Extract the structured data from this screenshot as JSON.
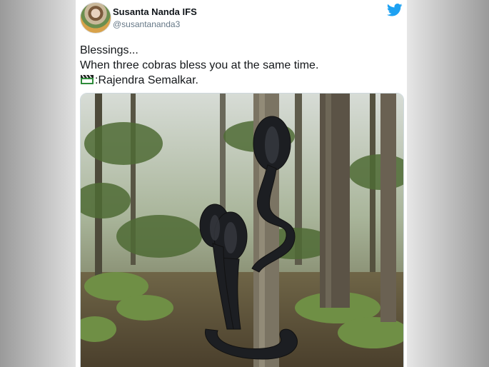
{
  "tweet": {
    "author_name": "Susanta Nanda IFS",
    "author_handle": "@susantananda3",
    "text_line_1": "Blessings...",
    "text_line_2": "When three cobras bless you at the same time.",
    "credit": ":Rajendra Semalkar.",
    "icons": [
      "twitter-bird-icon",
      "clapperboard-icon"
    ],
    "brand_color": "#1da1f2"
  },
  "photo": {
    "subject": "three black cobras coiled around a tree trunk in a forest"
  }
}
